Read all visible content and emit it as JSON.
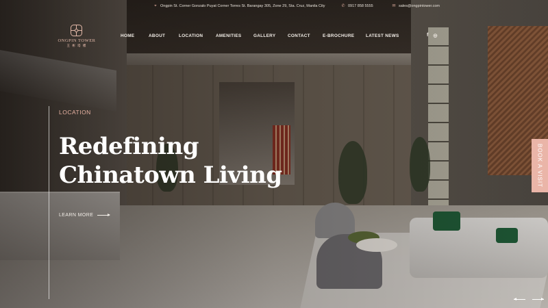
{
  "topbar": {
    "address": "Ongpin St. Corner Gonzalo Puyat Corner Torres St. Barangay 305, Zone 29, Sta. Cruz, Manila City",
    "phone": "0917 858 5555",
    "email": "sales@ongpintower.com",
    "address_icon": "location-pin-icon",
    "phone_icon": "phone-icon",
    "email_icon": "envelope-icon"
  },
  "logo": {
    "name": "ONGPIN TOWER",
    "sub": "王 彬 塔 樓"
  },
  "nav": {
    "items": [
      {
        "label": "HOME",
        "active": true
      },
      {
        "label": "ABOUT"
      },
      {
        "label": "LOCATION"
      },
      {
        "label": "AMENITIES"
      },
      {
        "label": "GALLERY"
      },
      {
        "label": "CONTACT"
      },
      {
        "label": "E-BROCHURE"
      },
      {
        "label": "LATEST NEWS"
      }
    ],
    "social": [
      "f",
      "◎"
    ]
  },
  "hero": {
    "eyebrow": "LOCATION",
    "headline_line1": "Redefining",
    "headline_line2": "Chinatown Living",
    "cta": "LEARN MORE"
  },
  "book_visit": "BOOK A VISIT",
  "colors": {
    "accent": "#e8b3a3",
    "book_tab": "#eab5a8",
    "text_light": "#f3eee8"
  }
}
